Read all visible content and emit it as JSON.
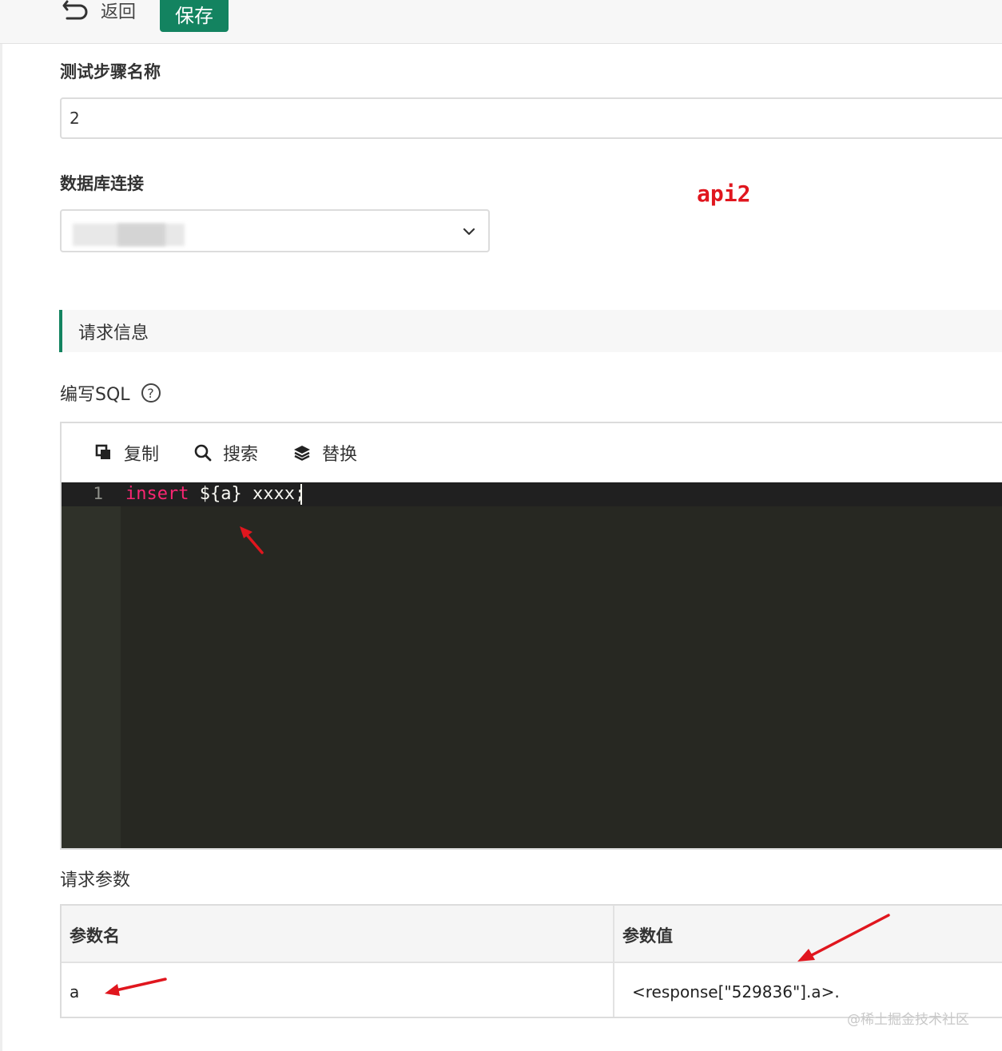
{
  "topbar": {
    "back_label": "返回",
    "save_label": "保存"
  },
  "form": {
    "step_name_label": "测试步骤名称",
    "step_name_value": "2",
    "db_connection_label": "数据库连接"
  },
  "annotation_label": "api2",
  "request_section": {
    "title": "请求信息"
  },
  "sql": {
    "label": "编写SQL",
    "help_glyph": "?",
    "toolbar": {
      "copy": "复制",
      "search": "搜索",
      "replace": "替换"
    },
    "line_number": "1",
    "code_keyword": "insert",
    "code_rest": " ${a} xxxx;"
  },
  "params": {
    "label": "请求参数",
    "columns": [
      "参数名",
      "参数值"
    ],
    "rows": [
      {
        "name": "a",
        "value": "<response[\"529836\"].a>."
      }
    ]
  },
  "watermark": "@稀土掘金技术社区",
  "colors": {
    "accent": "#138360",
    "annotation": "#e0161e",
    "editor_bg": "#272822",
    "keyword": "#f92672"
  }
}
